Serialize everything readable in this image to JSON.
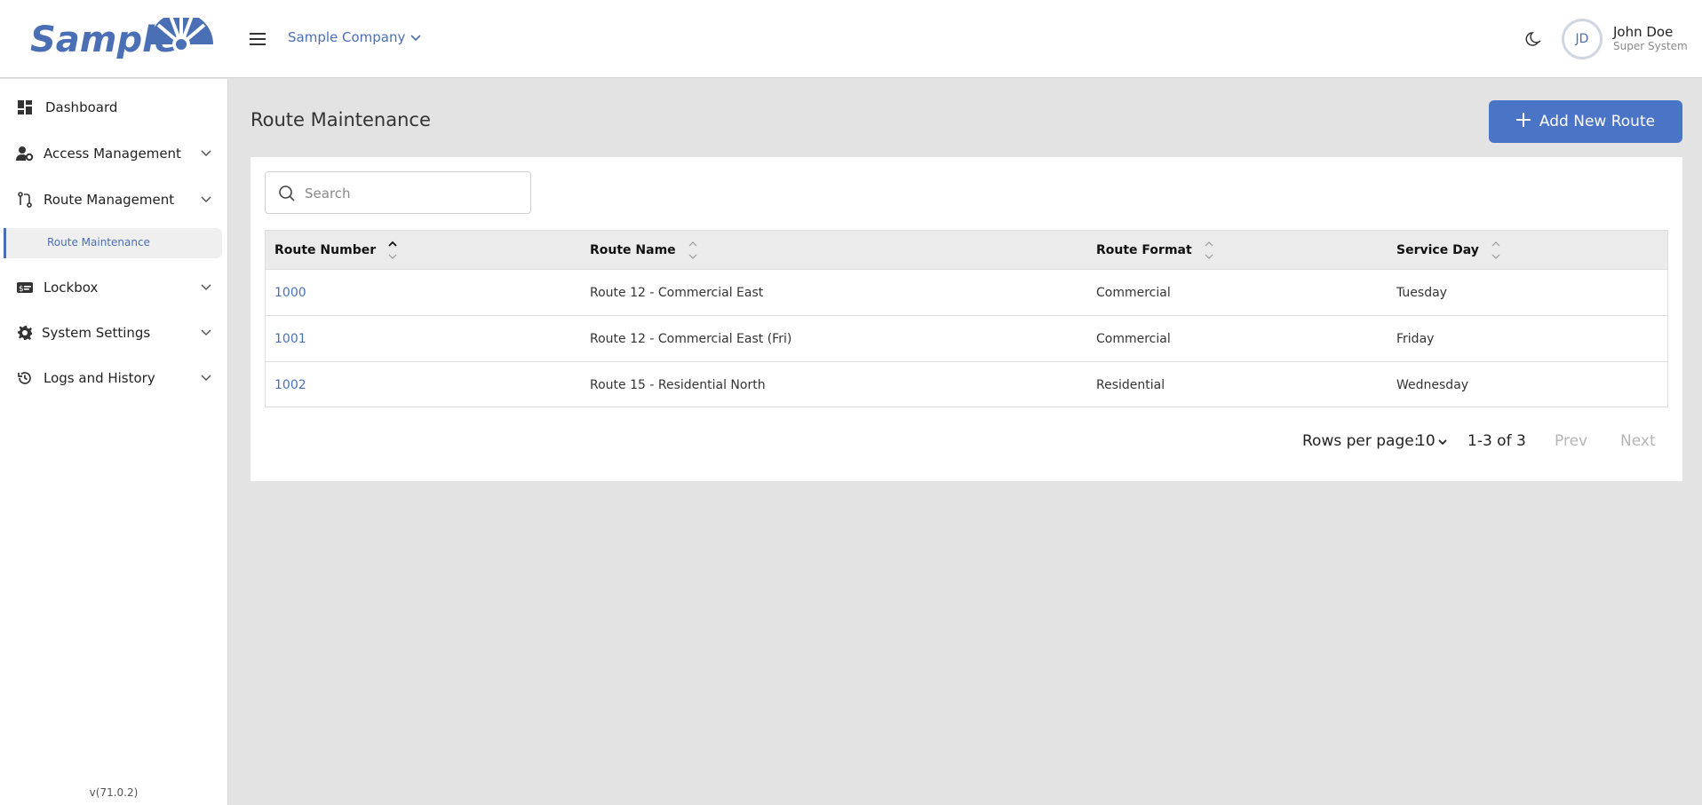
{
  "header": {
    "logo_text": "Sample",
    "company": "Sample Company",
    "user": {
      "initials": "JD",
      "name": "John Doe",
      "role": "Super System"
    }
  },
  "sidebar": {
    "items": [
      {
        "label": "Dashboard",
        "icon": "dashboard-icon"
      },
      {
        "label": "Access Management",
        "icon": "user-gear-icon"
      },
      {
        "label": "Route Management",
        "icon": "route-icon"
      },
      {
        "label": "Lockbox",
        "icon": "lockbox-icon"
      },
      {
        "label": "System Settings",
        "icon": "gear-icon"
      },
      {
        "label": "Logs and History",
        "icon": "history-icon"
      }
    ],
    "sub_item": "Route Maintenance",
    "version": "v(71.0.2)"
  },
  "main": {
    "title": "Route Maintenance",
    "add_button": "Add New Route",
    "search_placeholder": "Search",
    "columns": [
      "Route Number",
      "Route Name",
      "Route Format",
      "Service Day"
    ],
    "rows": [
      [
        "1000",
        "Route 12 - Commercial East",
        "Commercial",
        "Tuesday"
      ],
      [
        "1001",
        "Route 12 - Commercial East (Fri)",
        "Commercial",
        "Friday"
      ],
      [
        "1002",
        "Route 15 - Residential North",
        "Residential",
        "Wednesday"
      ]
    ],
    "pagination": {
      "rows_per_page_label": "Rows per page:",
      "rows_per_page": "10",
      "range": "1-3 of 3",
      "prev": "Prev",
      "next": "Next"
    }
  },
  "colors": {
    "accent": "#4a74c5",
    "link": "#4a6fb5",
    "background": "#e3e3e3"
  }
}
